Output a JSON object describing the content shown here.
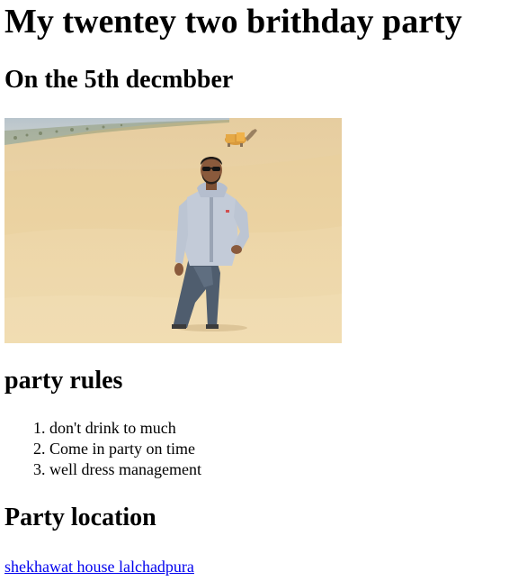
{
  "heading": "My twentey two brithday party",
  "date_heading": "On the 5th decmbber",
  "photo": {
    "description": "photo"
  },
  "rules_heading": "party rules",
  "rules": [
    "don't drink to much",
    "Come in party on time",
    "well dress management"
  ],
  "location_heading": "Party location",
  "location_link": "shekhawat house lalchadpura",
  "colors": {
    "link": "#0000ee",
    "text": "#000000",
    "background": "#ffffff",
    "sand": "#e8cf9e"
  }
}
